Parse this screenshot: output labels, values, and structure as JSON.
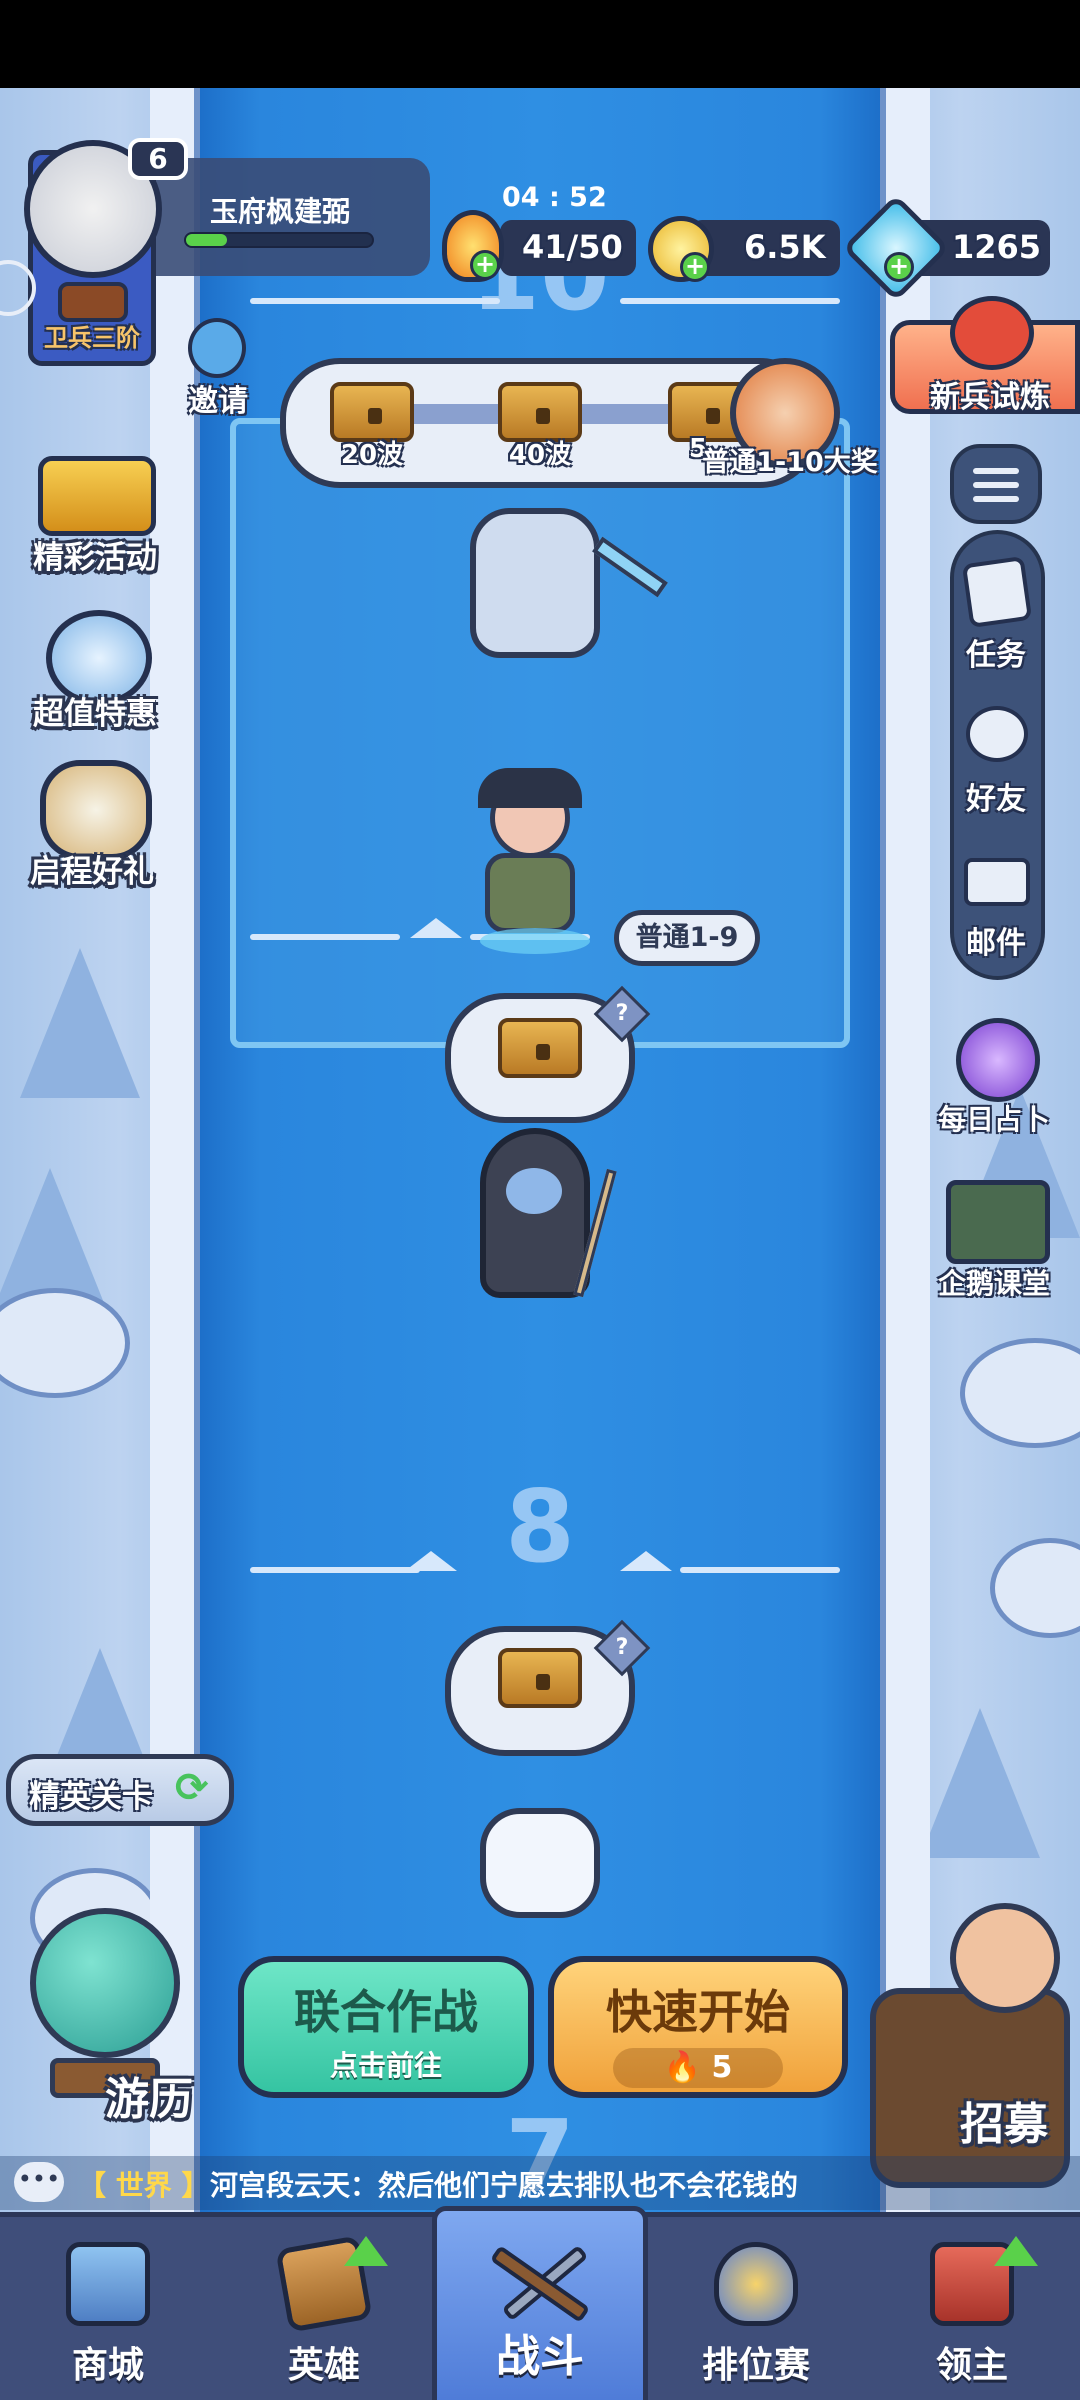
{
  "player": {
    "level": "6",
    "name": "玉府枫建弼",
    "rank": "卫兵三阶",
    "xp_progress": 0.22
  },
  "timer": "04 : 52",
  "resources": {
    "energy": "41/50",
    "gold": "6.5K",
    "gems": "1265"
  },
  "invite_label": "邀请",
  "left_menu": [
    {
      "label": "精彩活动"
    },
    {
      "label": "超值特惠"
    },
    {
      "label": "启程好礼"
    }
  ],
  "new_trial_label": "新兵试炼",
  "right_menu": [
    {
      "label": "任务"
    },
    {
      "label": "好友"
    },
    {
      "label": "邮件"
    }
  ],
  "daily_fortune_label": "每日占卜",
  "penguin_class_label": "企鹅课堂",
  "milestones": {
    "items": [
      "20波",
      "40波",
      "5"
    ],
    "grand_prize": "普通1-10大奖"
  },
  "stage_tag": "普通1-9",
  "wave_numbers": {
    "top": "10",
    "middle": "8",
    "bottom": "7"
  },
  "elite_stage_label": "精英关卡",
  "journey_label": "游历",
  "recruit_label": "招募",
  "coop_button": {
    "title": "联合作战",
    "subtitle": "点击前往"
  },
  "quick_start_button": {
    "title": "快速开始",
    "cost": "5"
  },
  "chat": {
    "channel": "【 世界 】",
    "message": "河宫段云天：然后他们宁愿去排队也不会花钱的"
  },
  "tabs": [
    {
      "label": "商城"
    },
    {
      "label": "英雄"
    },
    {
      "label": "战斗"
    },
    {
      "label": "排位赛"
    },
    {
      "label": "领主"
    }
  ],
  "colors": {
    "accent_green": "#4fd9b0",
    "accent_orange": "#f4a63a",
    "tab_active": "#5d8ae0"
  }
}
